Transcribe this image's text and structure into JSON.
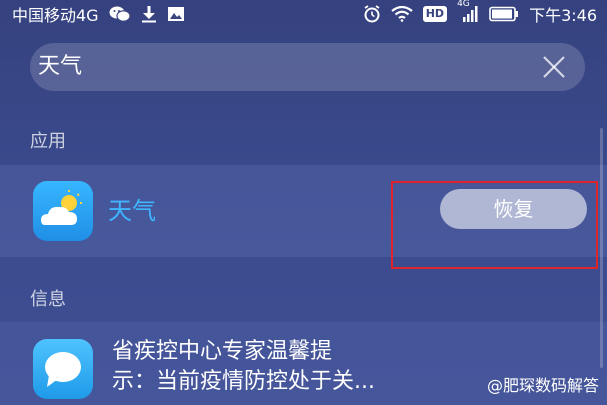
{
  "status_bar": {
    "carrier": "中国移动4G",
    "time": "下午3:46",
    "badge_hd": "HD",
    "badge_4g": "4G"
  },
  "search": {
    "query": "天气"
  },
  "sections": {
    "apps_header": "应用",
    "info_header": "信息"
  },
  "app_result": {
    "name": "天气",
    "icon": "weather-icon",
    "action_label": "恢复"
  },
  "info_result": {
    "icon": "message-icon",
    "text": "省疾控中心专家温馨提\n示：当前疫情防控处于关..."
  },
  "watermark": {
    "text": "@肥琛数码解答"
  },
  "colors": {
    "background": "#3a4a8c",
    "app_name": "#3fb5ff",
    "highlight": "#e0242c"
  }
}
